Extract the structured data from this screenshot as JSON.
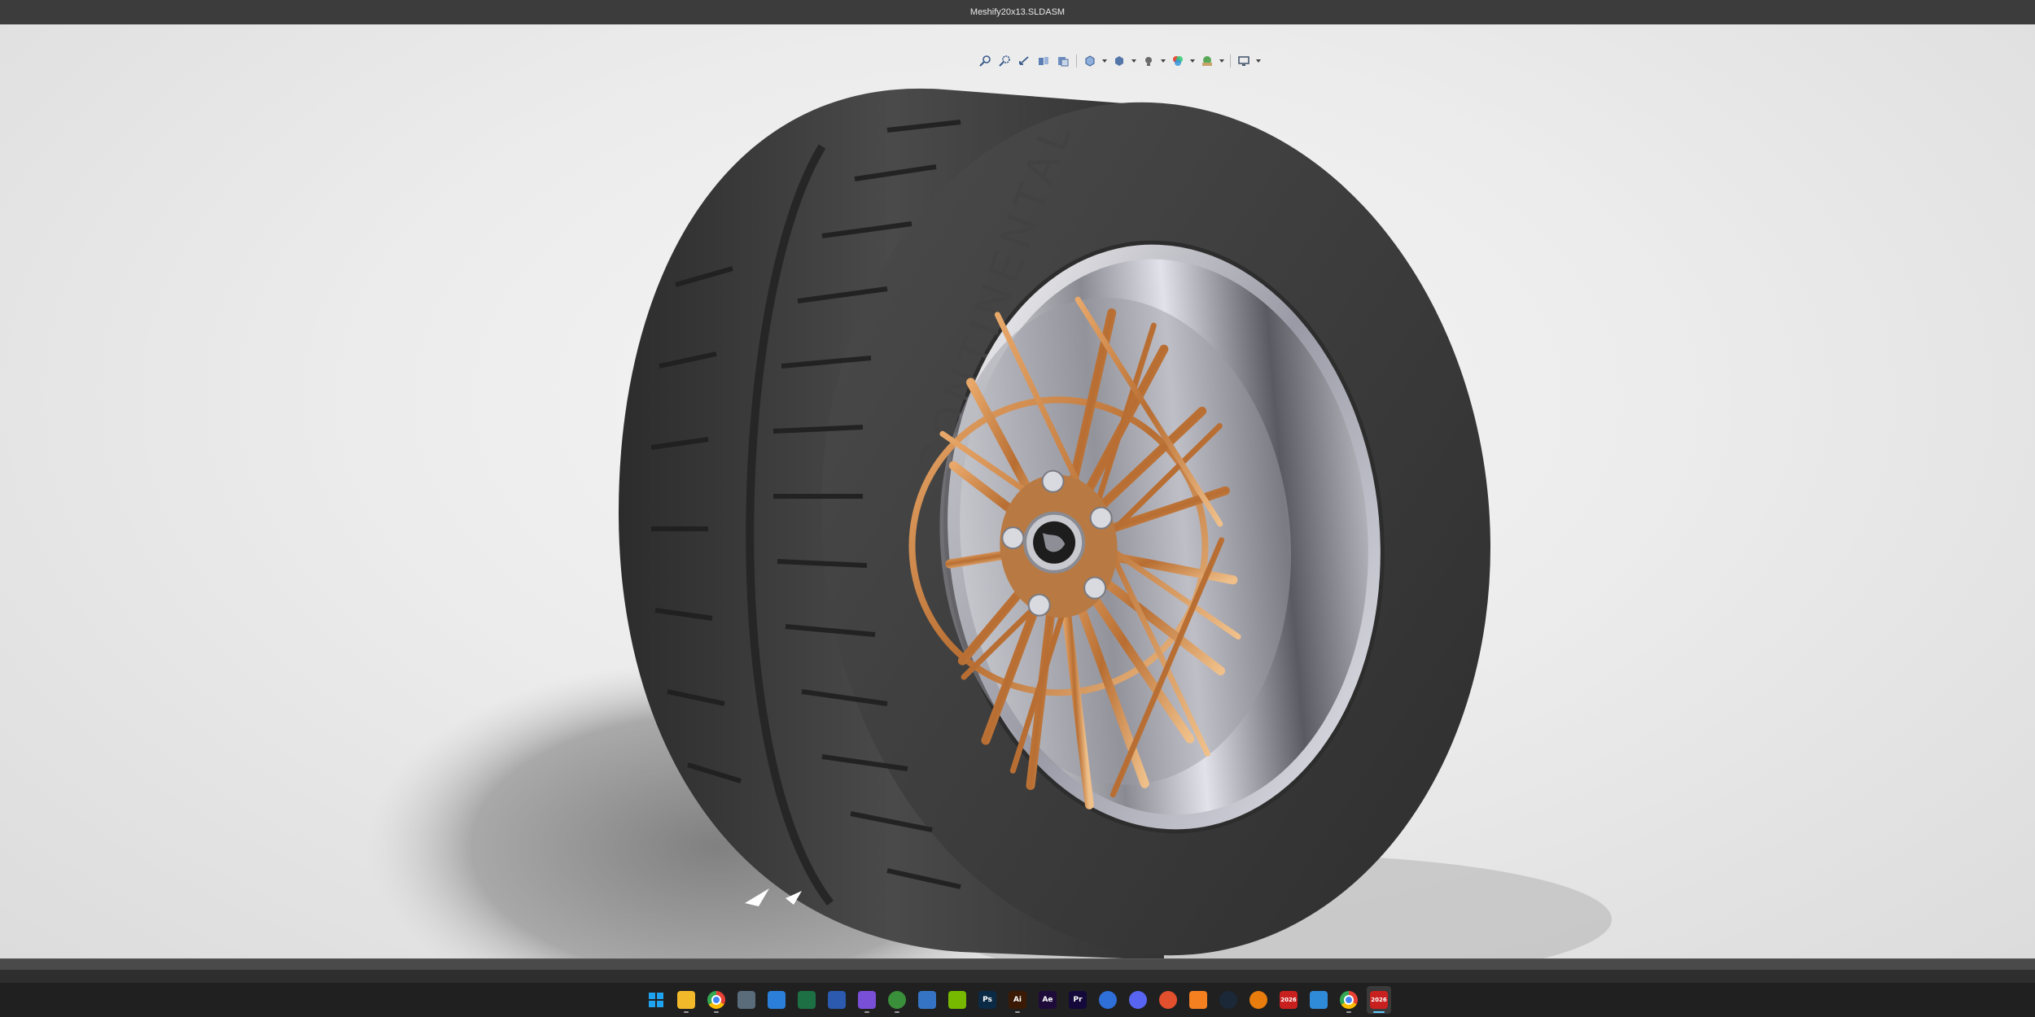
{
  "window": {
    "title": "Meshify20x13.SLDASM"
  },
  "heads_up_toolbar": {
    "buttons": [
      {
        "name": "zoom-to-fit-icon",
        "has_dropdown": false
      },
      {
        "name": "zoom-to-area-icon",
        "has_dropdown": false
      },
      {
        "name": "previous-view-icon",
        "has_dropdown": false
      },
      {
        "name": "section-view-icon",
        "has_dropdown": false
      },
      {
        "name": "dynamic-annotation-icon",
        "has_dropdown": false
      },
      {
        "name": "view-orientation-icon",
        "has_dropdown": true
      },
      {
        "name": "display-style-icon",
        "has_dropdown": true
      },
      {
        "name": "hide-show-items-icon",
        "has_dropdown": true
      },
      {
        "name": "edit-appearance-icon",
        "has_dropdown": true
      },
      {
        "name": "apply-scene-icon",
        "has_dropdown": true
      },
      {
        "name": "view-settings-icon",
        "has_dropdown": true
      }
    ]
  },
  "model": {
    "tire_sidewall_text": [
      "CONTINENTAL",
      "EXTREME CONTACT"
    ],
    "colors": {
      "tire": "#3d3d3d",
      "tire_dark": "#2a2a2a",
      "rim_gold": "#c9844a",
      "rim_chrome": "#d8d8e0",
      "background": "#ececec"
    }
  },
  "taskbar": {
    "items": [
      {
        "name": "windows-start-icon",
        "label": "",
        "color": "#0a7cd6",
        "running": false
      },
      {
        "name": "file-explorer-icon",
        "label": "",
        "color": "#f2b92a",
        "running": true
      },
      {
        "name": "chrome-icon",
        "label": "",
        "color": "#e94235",
        "running": true
      },
      {
        "name": "calculator-icon",
        "label": "",
        "color": "#5a6b7a",
        "running": false
      },
      {
        "name": "microsoft-store-icon",
        "label": "",
        "color": "#2b7fd8",
        "running": false
      },
      {
        "name": "excel-icon",
        "label": "",
        "color": "#1d7044",
        "running": false
      },
      {
        "name": "word-icon",
        "label": "",
        "color": "#2b5aaf",
        "running": false
      },
      {
        "name": "camera-app-icon",
        "label": "",
        "color": "#7a4fd8",
        "running": true
      },
      {
        "name": "xbox-icon",
        "label": "",
        "color": "#3a8f3a",
        "running": true
      },
      {
        "name": "phone-link-icon",
        "label": "",
        "color": "#3574c4",
        "running": false
      },
      {
        "name": "nvidia-icon",
        "label": "",
        "color": "#76b900",
        "running": false
      },
      {
        "name": "photoshop-icon",
        "label": "Ps",
        "color": "#0b2a46",
        "running": false
      },
      {
        "name": "illustrator-icon",
        "label": "Ai",
        "color": "#3a1a05",
        "running": true
      },
      {
        "name": "after-effects-icon",
        "label": "Ae",
        "color": "#1e0b3a",
        "running": false
      },
      {
        "name": "premiere-pro-icon",
        "label": "Pr",
        "color": "#14093a",
        "running": false
      },
      {
        "name": "thunderbird-icon",
        "label": "",
        "color": "#2f6fd8",
        "running": false
      },
      {
        "name": "discord-icon",
        "label": "",
        "color": "#5865f2",
        "running": false
      },
      {
        "name": "ea-app-icon",
        "label": "",
        "color": "#e2502e",
        "running": false
      },
      {
        "name": "fusion-icon",
        "label": "",
        "color": "#f58020",
        "running": false
      },
      {
        "name": "steam-icon",
        "label": "",
        "color": "#1b2838",
        "running": false
      },
      {
        "name": "blender-icon",
        "label": "",
        "color": "#e87d0d",
        "running": false
      },
      {
        "name": "solidworks-2026-icon",
        "label": "2026",
        "color": "#c8201f",
        "running": false
      },
      {
        "name": "3d-viewer-icon",
        "label": "",
        "color": "#2f8ad8",
        "running": false
      },
      {
        "name": "chrome-profile-icon",
        "label": "",
        "color": "#e94235",
        "running": true
      },
      {
        "name": "solidworks-2026-active-icon",
        "label": "2026",
        "color": "#c8201f",
        "running": true,
        "active": true
      }
    ]
  }
}
